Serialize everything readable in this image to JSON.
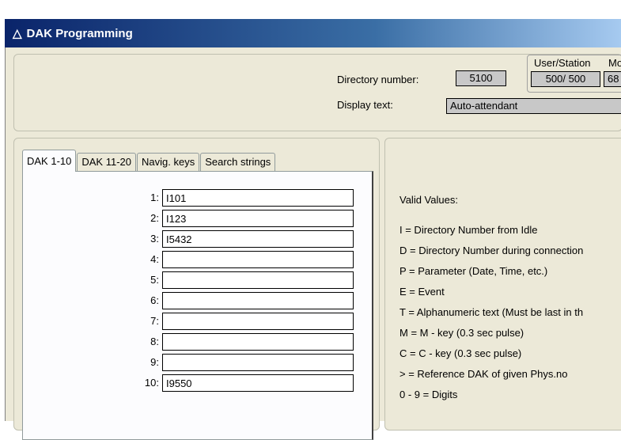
{
  "window": {
    "title": "DAK Programming"
  },
  "header": {
    "directory_label": "Directory number:",
    "directory_value": "5100",
    "display_label": "Display text:",
    "display_value": "Auto-attendant",
    "user_station_label": "User/Station",
    "user_station_value": "500/ 500",
    "mo_label": "Mo",
    "mo_value": "68"
  },
  "tabs": [
    {
      "label": "DAK 1-10",
      "active": true
    },
    {
      "label": "DAK 11-20",
      "active": false
    },
    {
      "label": "Navig. keys",
      "active": false
    },
    {
      "label": "Search strings",
      "active": false
    }
  ],
  "dak_rows": [
    {
      "num": "1:",
      "value": "I101"
    },
    {
      "num": "2:",
      "value": "I123"
    },
    {
      "num": "3:",
      "value": "I5432"
    },
    {
      "num": "4:",
      "value": ""
    },
    {
      "num": "5:",
      "value": ""
    },
    {
      "num": "6:",
      "value": ""
    },
    {
      "num": "7:",
      "value": ""
    },
    {
      "num": "8:",
      "value": ""
    },
    {
      "num": "9:",
      "value": ""
    },
    {
      "num": "10:",
      "value": "I9550"
    }
  ],
  "valid_values": {
    "heading": "Valid Values:",
    "items": [
      "I = Directory Number from Idle",
      "D = Directory Number during connection",
      "P = Parameter (Date, Time, etc.)",
      "E = Event",
      "T = Alphanumeric text (Must be last in th",
      "M = M - key (0.3 sec pulse)",
      "C = C - key (0.3 sec pulse)",
      "> = Reference DAK of given Phys.no",
      "0 - 9 = Digits"
    ]
  }
}
